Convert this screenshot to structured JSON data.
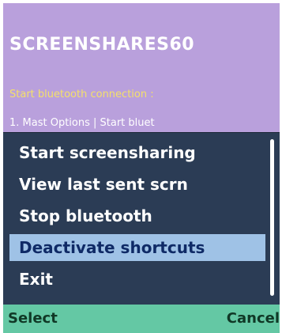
{
  "app": {
    "title": "SCREENSHARES60",
    "instructions_heading": "Start bluetooth connection :",
    "instructions_line1": "1. Mast   Options | Start bluet"
  },
  "menu": {
    "items": [
      {
        "label": "Start screensharing",
        "selected": false
      },
      {
        "label": "View last sent scrn",
        "selected": false
      },
      {
        "label": "Stop bluetooth",
        "selected": false
      },
      {
        "label": "Deactivate shortcuts",
        "selected": true
      },
      {
        "label": "Exit",
        "selected": false
      }
    ]
  },
  "softkeys": {
    "left": "Select",
    "right": "Cancel"
  },
  "colors": {
    "background": "#b9a0dc",
    "menu_bg": "#2b3c55",
    "selection": "#9fc2e6",
    "softkey_bar": "#64c8a4",
    "instruction_heading": "#f4e06a"
  }
}
